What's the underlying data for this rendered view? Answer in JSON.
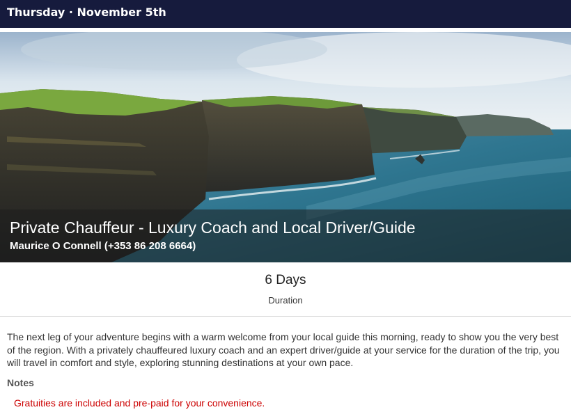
{
  "day": {
    "header": "Thursday · November 5th"
  },
  "hero": {
    "title": "Private Chauffeur - Luxury Coach and Local Driver/Guide",
    "subtitle": "Maurice O Connell (+353 86 208 6664)"
  },
  "duration": {
    "value": "6 Days",
    "label": "Duration"
  },
  "description": "The next leg of your adventure begins with a warm welcome from your local guide this morning, ready to show you the very best of the region. With a privately chauffeured luxury coach and an expert driver/guide at your service for the duration of the trip, you will travel in comfort and style, exploring stunning destinations at your own pace.",
  "notes": {
    "heading": "Notes",
    "text": "Gratuities are included and pre-paid for your convenience."
  },
  "colors": {
    "header_bg": "#161b3d",
    "note_red": "#cc0000"
  }
}
